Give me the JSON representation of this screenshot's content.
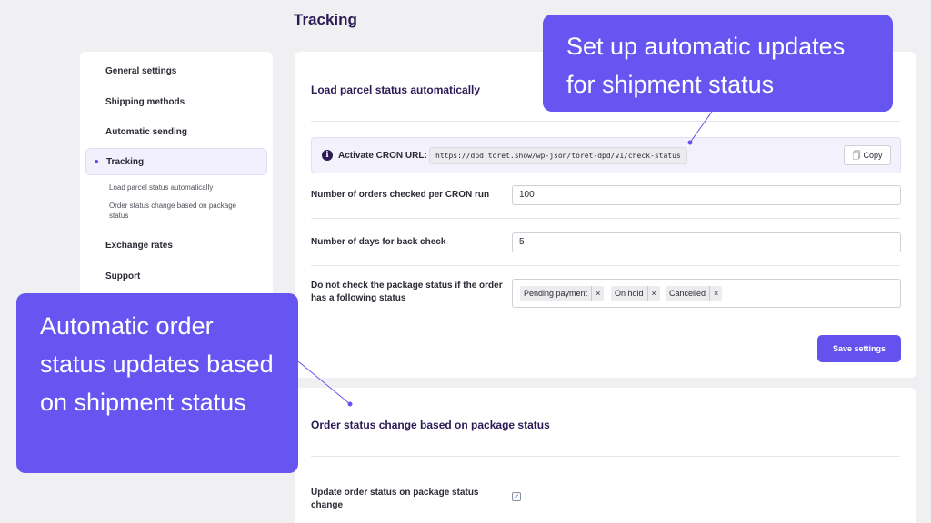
{
  "page": {
    "title": "Tracking"
  },
  "sidebar": {
    "items": [
      {
        "label": "General settings"
      },
      {
        "label": "Shipping methods"
      },
      {
        "label": "Automatic sending"
      },
      {
        "label": "Tracking",
        "active": true
      },
      {
        "label": "Exchange rates"
      },
      {
        "label": "Support"
      }
    ],
    "subitems": [
      {
        "label": "Load parcel status automatically"
      },
      {
        "label": "Order status change based on package status"
      }
    ]
  },
  "load_section": {
    "title": "Load parcel status automatically",
    "cron": {
      "icon": "info-icon",
      "label": "Activate CRON URL:",
      "url": "https://dpd.toret.show/wp-json/toret-dpd/v1/check-status",
      "copy_icon": "copy-icon",
      "copy_label": "Copy"
    },
    "orders_per_run": {
      "label": "Number of orders checked per CRON run",
      "value": "100"
    },
    "days_back": {
      "label": "Number of days for back check",
      "value": "5"
    },
    "exclude_status": {
      "label": "Do not check the package status if the order has a following status",
      "tags": [
        {
          "label": "Pending payment",
          "remove": "×"
        },
        {
          "label": "On hold",
          "remove": "×"
        },
        {
          "label": "Cancelled",
          "remove": "×"
        }
      ]
    },
    "save_label": "Save settings"
  },
  "order_section": {
    "title": "Order status change based on package status",
    "update_status": {
      "label": "Update order status on package status change",
      "checked": true,
      "check_glyph": "✓"
    }
  },
  "callouts": {
    "top": "Set up automatic updates for shipment status",
    "left": "Automatic order status updates based on shipment status"
  },
  "colors": {
    "accent": "#6352ee",
    "callout": "#6655f0",
    "title": "#2b1a55",
    "background": "#f0f0f3"
  }
}
